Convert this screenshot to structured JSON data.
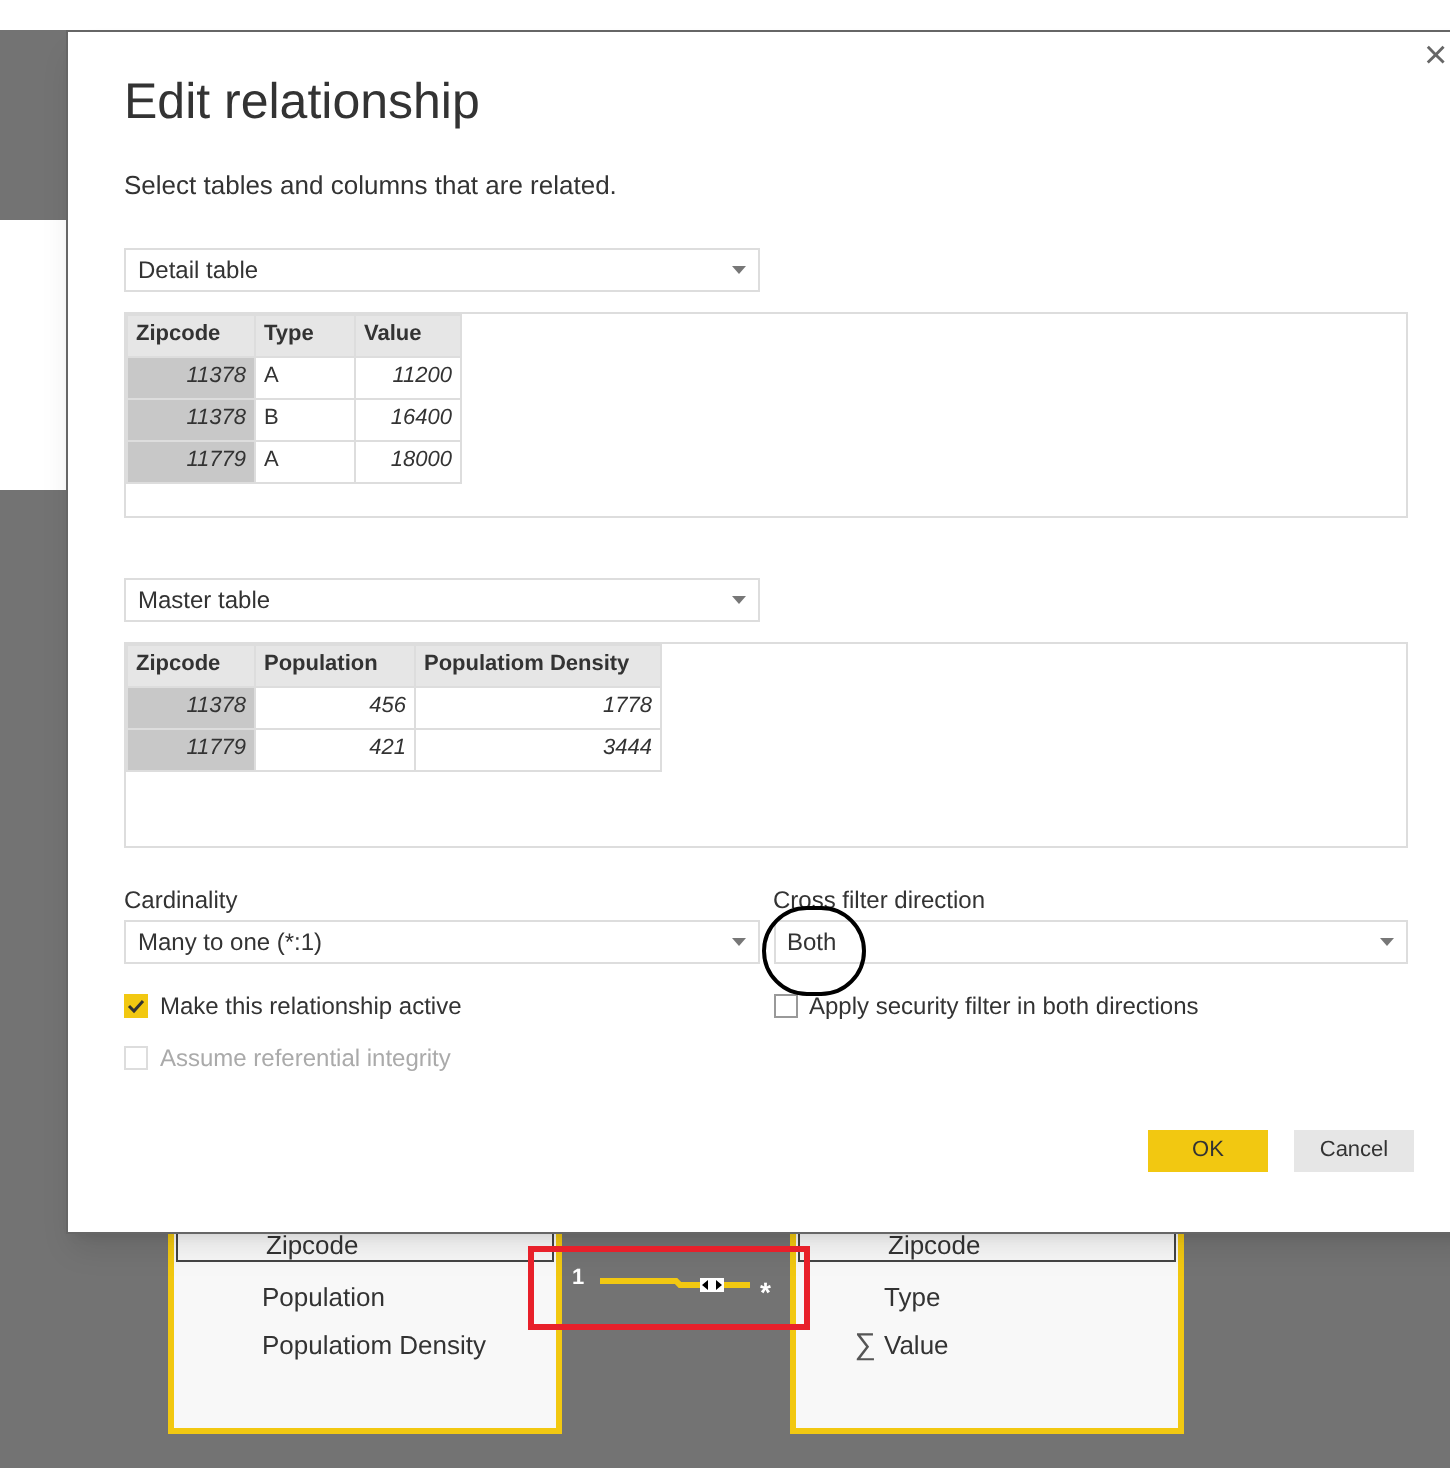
{
  "dialog": {
    "title": "Edit relationship",
    "close": "×",
    "subtitle": "Select tables and columns that are related.",
    "tables": [
      {
        "selector": "Detail table",
        "columns": [
          {
            "name": "Zipcode",
            "key": true,
            "numeric": true
          },
          {
            "name": "Type",
            "key": false,
            "numeric": false
          },
          {
            "name": "Value",
            "key": false,
            "numeric": true
          }
        ],
        "rows": [
          [
            "11378",
            "A",
            "11200"
          ],
          [
            "11378",
            "B",
            "16400"
          ],
          [
            "11779",
            "A",
            "18000"
          ]
        ]
      },
      {
        "selector": "Master table",
        "columns": [
          {
            "name": "Zipcode",
            "key": true,
            "numeric": true
          },
          {
            "name": "Population",
            "key": false,
            "numeric": true
          },
          {
            "name": "Populatiom Density",
            "key": false,
            "numeric": true
          }
        ],
        "rows": [
          [
            "11378",
            "456",
            "1778"
          ],
          [
            "11779",
            "421",
            "3444"
          ]
        ]
      }
    ],
    "cardinality": {
      "label": "Cardinality",
      "value": "Many to one (*:1)"
    },
    "cross_filter": {
      "label": "Cross filter direction",
      "value": "Both"
    },
    "options": [
      {
        "label": "Make this relationship active",
        "checked": true,
        "disabled": false
      },
      {
        "label": "Apply security filter in both directions",
        "checked": false,
        "disabled": false
      },
      {
        "label": "Assume referential integrity",
        "checked": false,
        "disabled": true
      }
    ],
    "buttons": [
      {
        "label": "OK",
        "kind": "primary"
      },
      {
        "label": "Cancel",
        "kind": "secondary"
      }
    ]
  },
  "diagram": {
    "tables": [
      {
        "fields": [
          {
            "name": "Zipcode"
          },
          {
            "name": "Population"
          },
          {
            "name": "Populatiom Density"
          }
        ]
      },
      {
        "fields": [
          {
            "name": "Zipcode"
          },
          {
            "name": "Type"
          },
          {
            "name": "Value",
            "sigma_glyph": "∑"
          }
        ]
      }
    ],
    "relationship": {
      "from_label": "1",
      "to_label": "*"
    }
  },
  "annotations": [
    {
      "kind": "circle"
    },
    {
      "kind": "rectangle"
    }
  ]
}
